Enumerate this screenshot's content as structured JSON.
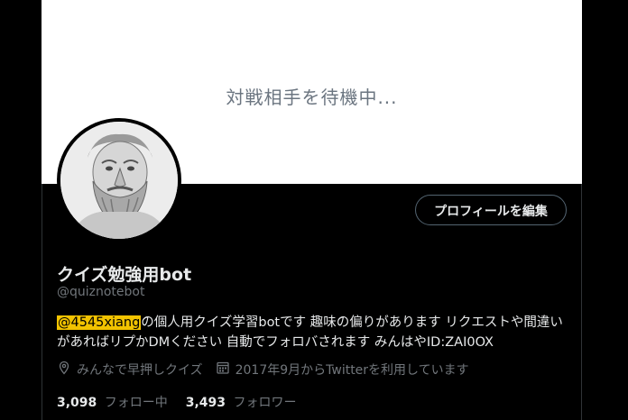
{
  "banner": {
    "text": "対戦相手を待機中..."
  },
  "profile": {
    "edit_button": "プロフィールを編集",
    "name": "クイズ勉強用bot",
    "handle": "@quiznotebot",
    "bio_mention": "@4545xiang",
    "bio_line1_rest": "の個人用クイズ学習botです 趣味の偏りがあります リクエストや間違い",
    "bio_line2": "があればリプかDMください 自動でフォロバされます みんはやID:ZAI0OX",
    "location": "みんなで早押しクイズ",
    "joined": "2017年9月からTwitterを利用しています",
    "following_count": "3,098",
    "following_label": "フォロー中",
    "followers_count": "3,493",
    "followers_label": "フォロワー"
  },
  "icons": {
    "location": "location-pin-icon",
    "calendar": "calendar-icon"
  }
}
